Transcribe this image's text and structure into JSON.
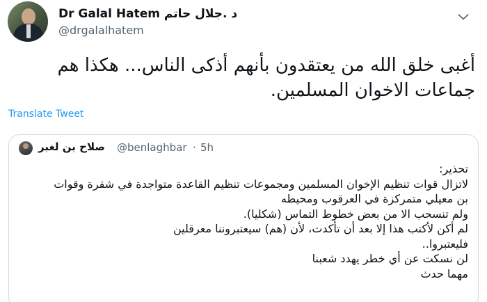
{
  "tweet": {
    "display_name": "Dr Galal Hatem د .جلال حاتم",
    "handle": "@drgalalhatem",
    "text_lines": [
      "أغبى خلق الله من يعتقدون بأنهم أذكى الناس... هكذا هم",
      "جماعات الاخوان المسلمين."
    ],
    "translate_label": "Translate Tweet",
    "more_icon": "chevron-down-icon"
  },
  "quoted_tweet": {
    "display_name": "صلاح بن لغبر",
    "handle": "@benlaghbar",
    "separator": "·",
    "time": "5h",
    "body_lines": [
      "تحذير:",
      "لاتزال قوات تنظيم الإخوان المسلمين ومجموعات تنظيم القاعدة متواجدة في شقرة وقوات",
      "بن معيلي متمركزة في العرقوب ومحيطه",
      "ولم تنسحب الا من بعض خطوط التماس (شكليا).",
      "لم أكن لأكتب هذا إلا بعد أن تأكدت، لأن (هم) سيعتبروننا معرقلين",
      "فليعتبروا..",
      "لن نسكت عن أي خطر يهدد شعبنا",
      "مهما حدث"
    ]
  },
  "colors": {
    "link": "#1d9bf0",
    "secondary_text": "#536471",
    "border": "#cfd9de"
  }
}
